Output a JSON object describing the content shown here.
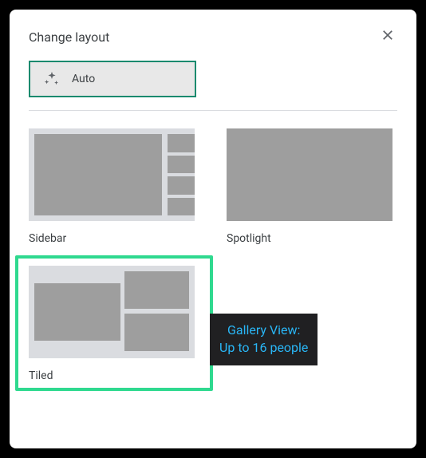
{
  "dialog": {
    "title": "Change layout"
  },
  "auto": {
    "label": "Auto"
  },
  "options": {
    "sidebar": {
      "label": "Sidebar"
    },
    "spotlight": {
      "label": "Spotlight"
    },
    "tiled": {
      "label": "Tiled"
    }
  },
  "tooltip": {
    "line1": "Gallery View:",
    "line2": "Up to 16 people"
  }
}
